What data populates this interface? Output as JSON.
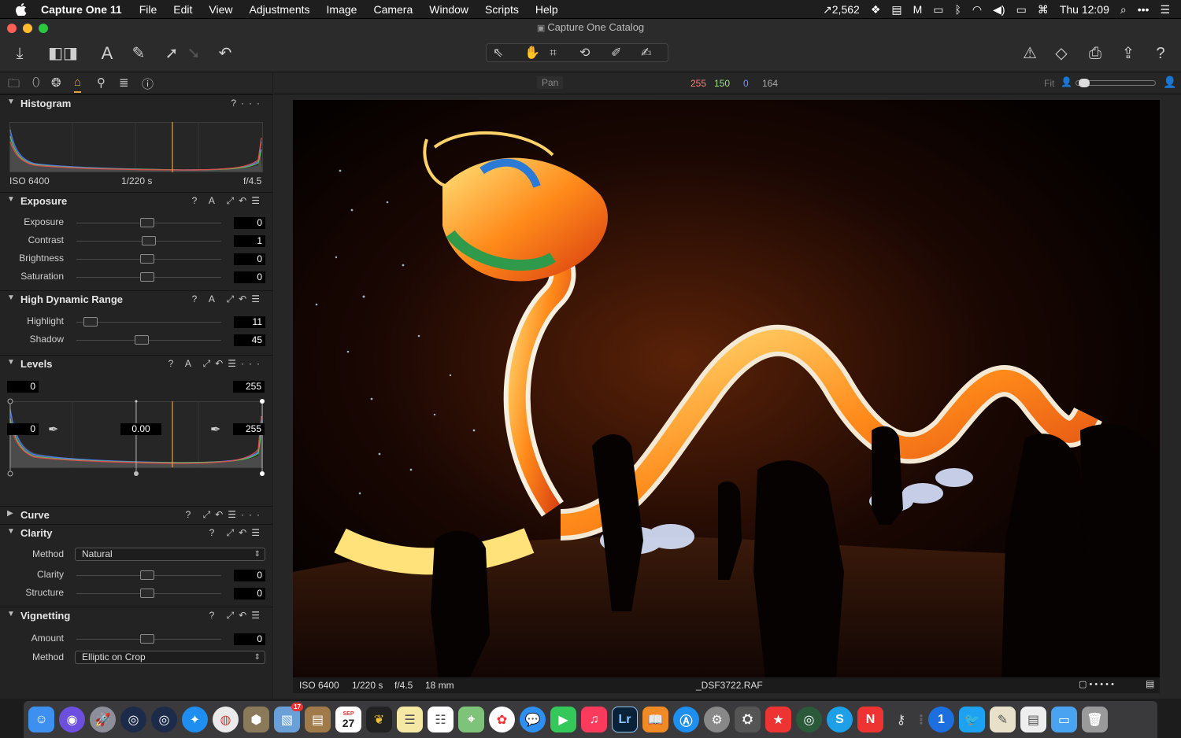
{
  "menubar": {
    "app_name": "Capture One 11",
    "items": [
      "File",
      "Edit",
      "View",
      "Adjustments",
      "Image",
      "Camera",
      "Window",
      "Scripts",
      "Help"
    ],
    "stat_value": "2,562",
    "clock": "Thu 12:09"
  },
  "window": {
    "title": "Capture One Catalog"
  },
  "viewer": {
    "mode": "Pan",
    "rgb": {
      "r": "255",
      "g": "150",
      "b": "0",
      "l": "164"
    },
    "zoom_label": "Fit"
  },
  "histogram": {
    "title": "Histogram",
    "help": "?",
    "more": "···",
    "iso": "ISO 6400",
    "shutter": "1/220 s",
    "aperture": "f/4.5"
  },
  "exposure": {
    "title": "Exposure",
    "actions": "? A",
    "sliders": [
      {
        "label": "Exposure",
        "value": "0",
        "pos": 0.49
      },
      {
        "label": "Contrast",
        "value": "1",
        "pos": 0.5
      },
      {
        "label": "Brightness",
        "value": "0",
        "pos": 0.49
      },
      {
        "label": "Saturation",
        "value": "0",
        "pos": 0.49
      }
    ]
  },
  "hdr": {
    "title": "High Dynamic Range",
    "actions": "? A",
    "sliders": [
      {
        "label": "Highlight",
        "value": "11",
        "pos": 0.1
      },
      {
        "label": "Shadow",
        "value": "45",
        "pos": 0.45
      }
    ]
  },
  "levels": {
    "title": "Levels",
    "actions": "? A",
    "top_left": "0",
    "top_right": "255",
    "bottom_left": "0",
    "bottom_mid": "0.00",
    "bottom_right": "255"
  },
  "curve": {
    "title": "Curve",
    "actions": "?"
  },
  "clarity": {
    "title": "Clarity",
    "actions": "?",
    "method_label": "Method",
    "method_value": "Natural",
    "sliders": [
      {
        "label": "Clarity",
        "value": "0",
        "pos": 0.49
      },
      {
        "label": "Structure",
        "value": "0",
        "pos": 0.49
      }
    ]
  },
  "vignetting": {
    "title": "Vignetting",
    "actions": "?",
    "sliders": [
      {
        "label": "Amount",
        "value": "0",
        "pos": 0.49
      }
    ],
    "method_label": "Method",
    "method_value": "Elliptic on Crop"
  },
  "photo_info": {
    "iso": "ISO 6400",
    "shutter": "1/220 s",
    "aperture": "f/4.5",
    "focal": "18 mm",
    "filename": "_DSF3722.RAF"
  },
  "dock": {
    "badge_photos": "17",
    "calendar_month": "SEP",
    "calendar_day": "27",
    "lr_label": "Lr",
    "onepassword_label": "1"
  },
  "colors": {
    "accent": "#e8a23a",
    "red": "#ff6b6b",
    "green": "#9be37a",
    "blue": "#5b8cff"
  }
}
